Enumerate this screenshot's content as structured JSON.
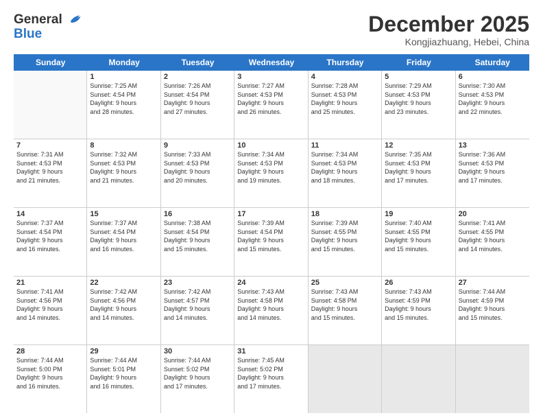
{
  "header": {
    "logo_line1": "General",
    "logo_line2": "Blue",
    "month": "December 2025",
    "location": "Kongjiazhuang, Hebei, China"
  },
  "weekdays": [
    "Sunday",
    "Monday",
    "Tuesday",
    "Wednesday",
    "Thursday",
    "Friday",
    "Saturday"
  ],
  "rows": [
    [
      {
        "day": "",
        "empty": true
      },
      {
        "day": "1",
        "lines": [
          "Sunrise: 7:25 AM",
          "Sunset: 4:54 PM",
          "Daylight: 9 hours",
          "and 28 minutes."
        ]
      },
      {
        "day": "2",
        "lines": [
          "Sunrise: 7:26 AM",
          "Sunset: 4:54 PM",
          "Daylight: 9 hours",
          "and 27 minutes."
        ]
      },
      {
        "day": "3",
        "lines": [
          "Sunrise: 7:27 AM",
          "Sunset: 4:53 PM",
          "Daylight: 9 hours",
          "and 26 minutes."
        ]
      },
      {
        "day": "4",
        "lines": [
          "Sunrise: 7:28 AM",
          "Sunset: 4:53 PM",
          "Daylight: 9 hours",
          "and 25 minutes."
        ]
      },
      {
        "day": "5",
        "lines": [
          "Sunrise: 7:29 AM",
          "Sunset: 4:53 PM",
          "Daylight: 9 hours",
          "and 23 minutes."
        ]
      },
      {
        "day": "6",
        "lines": [
          "Sunrise: 7:30 AM",
          "Sunset: 4:53 PM",
          "Daylight: 9 hours",
          "and 22 minutes."
        ]
      }
    ],
    [
      {
        "day": "7",
        "lines": [
          "Sunrise: 7:31 AM",
          "Sunset: 4:53 PM",
          "Daylight: 9 hours",
          "and 21 minutes."
        ]
      },
      {
        "day": "8",
        "lines": [
          "Sunrise: 7:32 AM",
          "Sunset: 4:53 PM",
          "Daylight: 9 hours",
          "and 21 minutes."
        ]
      },
      {
        "day": "9",
        "lines": [
          "Sunrise: 7:33 AM",
          "Sunset: 4:53 PM",
          "Daylight: 9 hours",
          "and 20 minutes."
        ]
      },
      {
        "day": "10",
        "lines": [
          "Sunrise: 7:34 AM",
          "Sunset: 4:53 PM",
          "Daylight: 9 hours",
          "and 19 minutes."
        ]
      },
      {
        "day": "11",
        "lines": [
          "Sunrise: 7:34 AM",
          "Sunset: 4:53 PM",
          "Daylight: 9 hours",
          "and 18 minutes."
        ]
      },
      {
        "day": "12",
        "lines": [
          "Sunrise: 7:35 AM",
          "Sunset: 4:53 PM",
          "Daylight: 9 hours",
          "and 17 minutes."
        ]
      },
      {
        "day": "13",
        "lines": [
          "Sunrise: 7:36 AM",
          "Sunset: 4:53 PM",
          "Daylight: 9 hours",
          "and 17 minutes."
        ]
      }
    ],
    [
      {
        "day": "14",
        "lines": [
          "Sunrise: 7:37 AM",
          "Sunset: 4:54 PM",
          "Daylight: 9 hours",
          "and 16 minutes."
        ]
      },
      {
        "day": "15",
        "lines": [
          "Sunrise: 7:37 AM",
          "Sunset: 4:54 PM",
          "Daylight: 9 hours",
          "and 16 minutes."
        ]
      },
      {
        "day": "16",
        "lines": [
          "Sunrise: 7:38 AM",
          "Sunset: 4:54 PM",
          "Daylight: 9 hours",
          "and 15 minutes."
        ]
      },
      {
        "day": "17",
        "lines": [
          "Sunrise: 7:39 AM",
          "Sunset: 4:54 PM",
          "Daylight: 9 hours",
          "and 15 minutes."
        ]
      },
      {
        "day": "18",
        "lines": [
          "Sunrise: 7:39 AM",
          "Sunset: 4:55 PM",
          "Daylight: 9 hours",
          "and 15 minutes."
        ]
      },
      {
        "day": "19",
        "lines": [
          "Sunrise: 7:40 AM",
          "Sunset: 4:55 PM",
          "Daylight: 9 hours",
          "and 15 minutes."
        ]
      },
      {
        "day": "20",
        "lines": [
          "Sunrise: 7:41 AM",
          "Sunset: 4:55 PM",
          "Daylight: 9 hours",
          "and 14 minutes."
        ]
      }
    ],
    [
      {
        "day": "21",
        "lines": [
          "Sunrise: 7:41 AM",
          "Sunset: 4:56 PM",
          "Daylight: 9 hours",
          "and 14 minutes."
        ]
      },
      {
        "day": "22",
        "lines": [
          "Sunrise: 7:42 AM",
          "Sunset: 4:56 PM",
          "Daylight: 9 hours",
          "and 14 minutes."
        ]
      },
      {
        "day": "23",
        "lines": [
          "Sunrise: 7:42 AM",
          "Sunset: 4:57 PM",
          "Daylight: 9 hours",
          "and 14 minutes."
        ]
      },
      {
        "day": "24",
        "lines": [
          "Sunrise: 7:43 AM",
          "Sunset: 4:58 PM",
          "Daylight: 9 hours",
          "and 14 minutes."
        ]
      },
      {
        "day": "25",
        "lines": [
          "Sunrise: 7:43 AM",
          "Sunset: 4:58 PM",
          "Daylight: 9 hours",
          "and 15 minutes."
        ]
      },
      {
        "day": "26",
        "lines": [
          "Sunrise: 7:43 AM",
          "Sunset: 4:59 PM",
          "Daylight: 9 hours",
          "and 15 minutes."
        ]
      },
      {
        "day": "27",
        "lines": [
          "Sunrise: 7:44 AM",
          "Sunset: 4:59 PM",
          "Daylight: 9 hours",
          "and 15 minutes."
        ]
      }
    ],
    [
      {
        "day": "28",
        "lines": [
          "Sunrise: 7:44 AM",
          "Sunset: 5:00 PM",
          "Daylight: 9 hours",
          "and 16 minutes."
        ]
      },
      {
        "day": "29",
        "lines": [
          "Sunrise: 7:44 AM",
          "Sunset: 5:01 PM",
          "Daylight: 9 hours",
          "and 16 minutes."
        ]
      },
      {
        "day": "30",
        "lines": [
          "Sunrise: 7:44 AM",
          "Sunset: 5:02 PM",
          "Daylight: 9 hours",
          "and 17 minutes."
        ]
      },
      {
        "day": "31",
        "lines": [
          "Sunrise: 7:45 AM",
          "Sunset: 5:02 PM",
          "Daylight: 9 hours",
          "and 17 minutes."
        ]
      },
      {
        "day": "",
        "empty": true,
        "shaded": true
      },
      {
        "day": "",
        "empty": true,
        "shaded": true
      },
      {
        "day": "",
        "empty": true,
        "shaded": true
      }
    ]
  ]
}
